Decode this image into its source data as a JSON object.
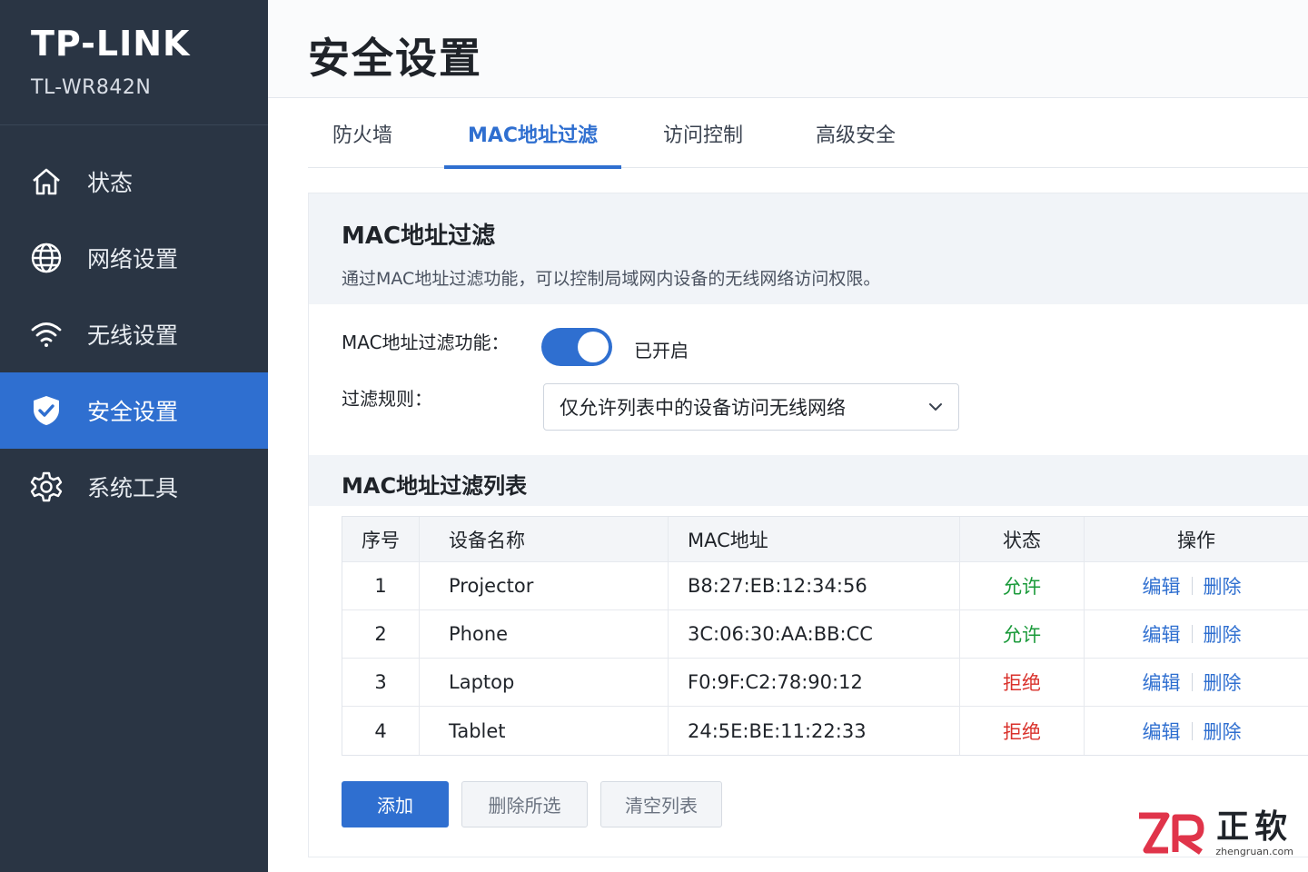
{
  "brand": {
    "logo": "TP-LINK",
    "model": "TL-WR842N"
  },
  "sidebar": {
    "items": [
      {
        "label": "状态",
        "icon": "home-icon",
        "active": false
      },
      {
        "label": "网络设置",
        "icon": "globe-icon",
        "active": false
      },
      {
        "label": "无线设置",
        "icon": "wifi-icon",
        "active": false
      },
      {
        "label": "安全设置",
        "icon": "shield-check-icon",
        "active": true
      },
      {
        "label": "系统工具",
        "icon": "gear-icon",
        "active": false
      }
    ]
  },
  "header": {
    "title": "安全设置"
  },
  "tabs": [
    {
      "label": "防火墙"
    },
    {
      "label": "MAC地址过滤",
      "active": true
    },
    {
      "label": "访问控制"
    },
    {
      "label": "高级安全"
    }
  ],
  "panel": {
    "title": "MAC地址过滤",
    "description": "通过MAC地址过滤功能，可以控制局域网内设备的无线网络访问权限。",
    "toggle_label": "MAC地址过滤功能：",
    "toggle_state": "已开启",
    "rule_label": "过滤规则：",
    "rule_value": "仅允许列表中的设备访问无线网络",
    "list_title": "MAC地址过滤列表"
  },
  "table": {
    "headers": [
      "序号",
      "设备名称",
      "MAC地址",
      "状态",
      "操作"
    ],
    "rows": [
      {
        "index": "1",
        "name": "Projector",
        "mac": "B8:27:EB:12:34:56",
        "status": "允许",
        "allowed": true
      },
      {
        "index": "2",
        "name": "Phone",
        "mac": "3C:06:30:AA:BB:CC",
        "status": "允许",
        "allowed": true
      },
      {
        "index": "3",
        "name": "Laptop",
        "mac": "F0:9F:C2:78:90:12",
        "status": "拒绝",
        "allowed": false
      },
      {
        "index": "4",
        "name": "Tablet",
        "mac": "24:5E:BE:11:22:33",
        "status": "拒绝",
        "allowed": false
      }
    ],
    "edit_label": "编辑",
    "delete_label": "删除"
  },
  "buttons": {
    "add": "添加",
    "delete_selected": "删除所选",
    "clear_list": "清空列表"
  },
  "watermark": {
    "cn": "正软",
    "url": "zhengruan.com"
  },
  "colors": {
    "sidebar_bg": "#2a3544",
    "accent": "#2f6fd0",
    "allow": "#1a9a3a",
    "deny": "#d9312b"
  }
}
